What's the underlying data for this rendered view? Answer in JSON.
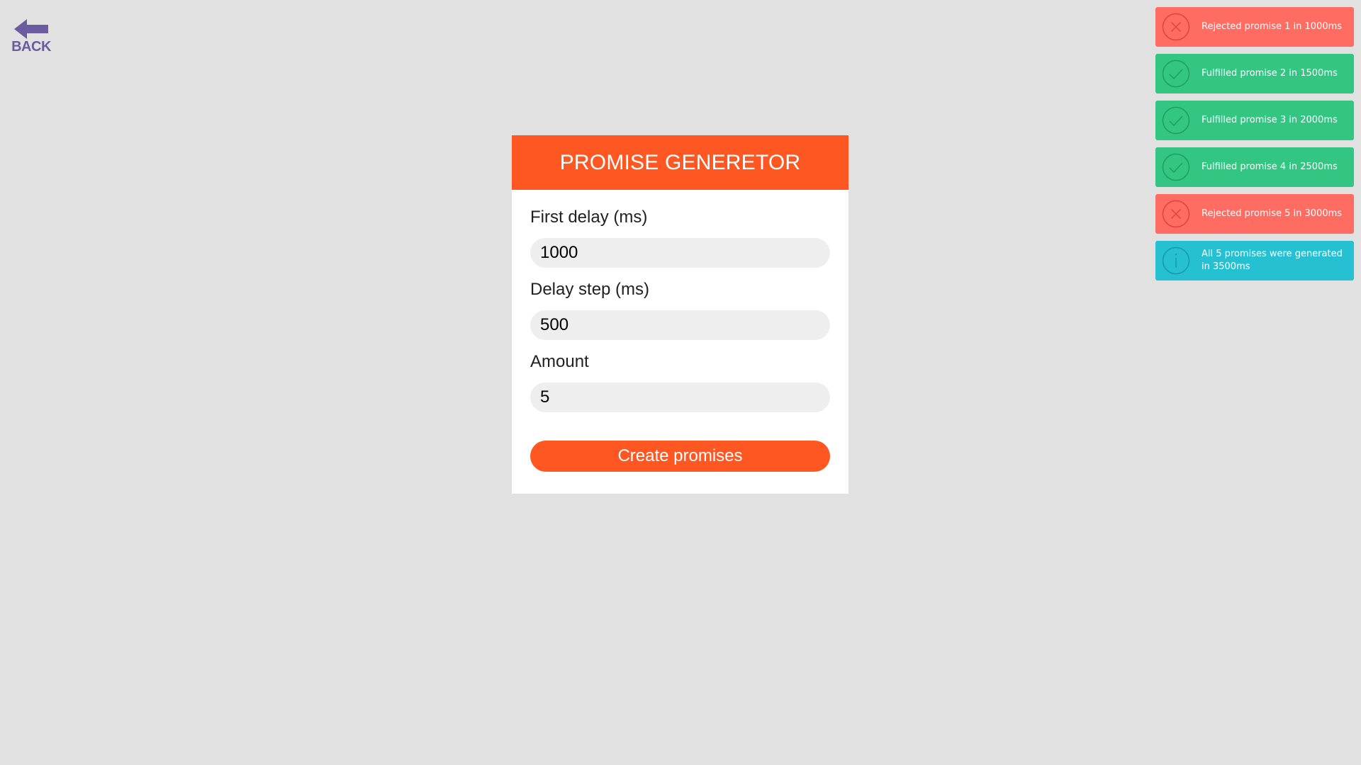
{
  "back": {
    "label": "BACK"
  },
  "card": {
    "title": "PROMISE GENERETOR",
    "fields": [
      {
        "label": "First delay (ms)",
        "value": "1000"
      },
      {
        "label": "Delay step (ms)",
        "value": "500"
      },
      {
        "label": "Amount",
        "value": "5"
      }
    ],
    "submit_label": "Create promises"
  },
  "notifications": [
    {
      "type": "failure",
      "icon": "close-icon",
      "text": "Rejected promise 1 in 1000ms"
    },
    {
      "type": "success",
      "icon": "check-icon",
      "text": "Fulfilled promise 2 in 1500ms"
    },
    {
      "type": "success",
      "icon": "check-icon",
      "text": "Fulfilled promise 3 in 2000ms"
    },
    {
      "type": "success",
      "icon": "check-icon",
      "text": "Fulfilled promise 4 in 2500ms"
    },
    {
      "type": "failure",
      "icon": "close-icon",
      "text": "Rejected promise 5 in 3000ms"
    },
    {
      "type": "info",
      "icon": "info-icon",
      "text": "All 5 promises were generated in 3500ms"
    }
  ],
  "colors": {
    "background": "#e1e1e1",
    "accent": "#ff5722",
    "back": "#6b5ba0",
    "failure": "#ff6c62",
    "success": "#32c682",
    "info": "#26c0d3"
  }
}
